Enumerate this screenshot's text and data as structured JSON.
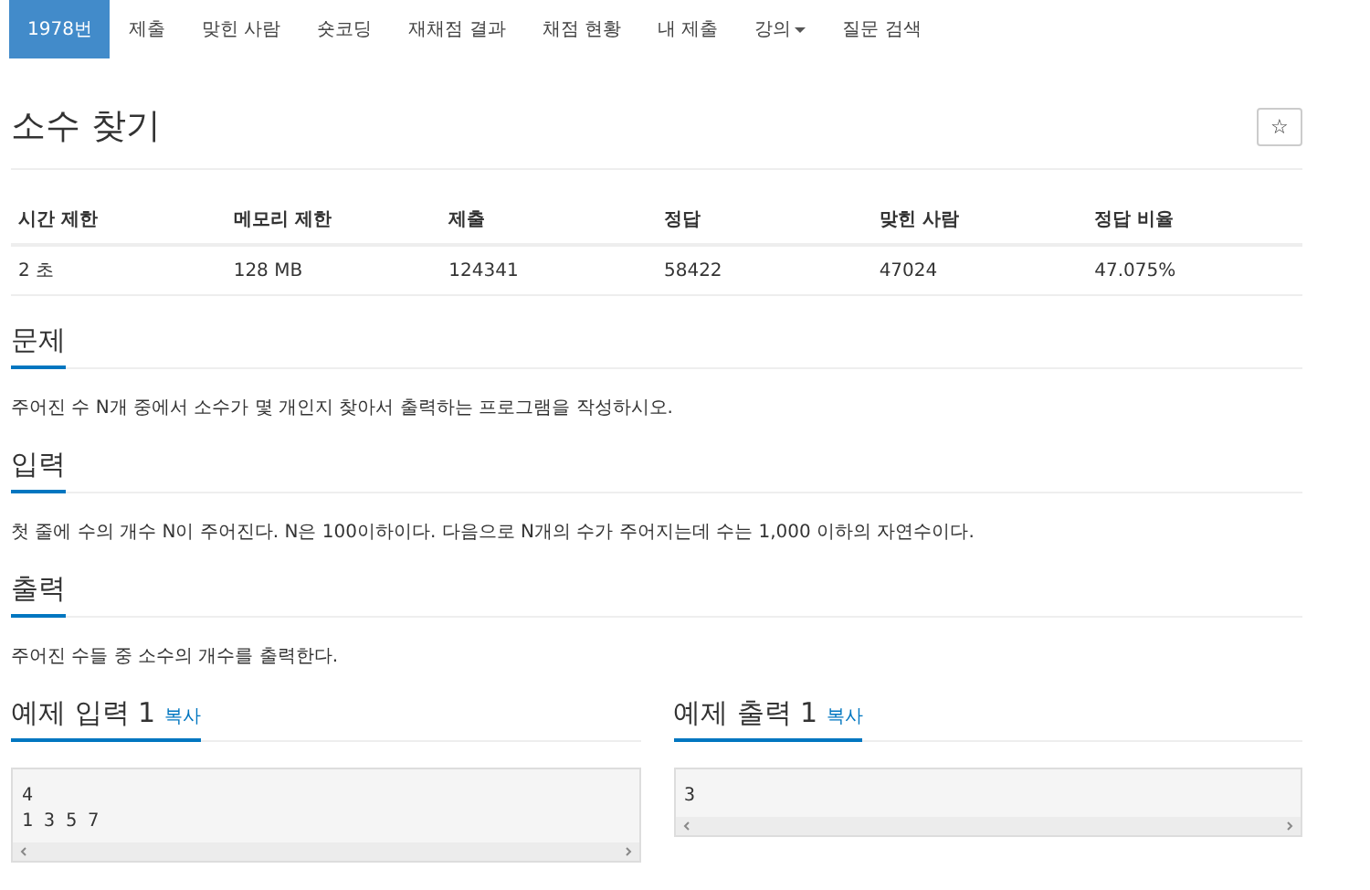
{
  "nav": [
    {
      "label": "1978번",
      "selected": true,
      "dropdown": false
    },
    {
      "label": "제출",
      "selected": false,
      "dropdown": false
    },
    {
      "label": "맞힌 사람",
      "selected": false,
      "dropdown": false
    },
    {
      "label": "숏코딩",
      "selected": false,
      "dropdown": false
    },
    {
      "label": "재채점 결과",
      "selected": false,
      "dropdown": false
    },
    {
      "label": "채점 현황",
      "selected": false,
      "dropdown": false
    },
    {
      "label": "내 제출",
      "selected": false,
      "dropdown": false
    },
    {
      "label": "강의",
      "selected": false,
      "dropdown": true
    },
    {
      "label": "질문 검색",
      "selected": false,
      "dropdown": false
    }
  ],
  "title": "소수 찾기",
  "star_button": "☆",
  "info_table": {
    "columns": [
      "시간 제한",
      "메모리 제한",
      "제출",
      "정답",
      "맞힌 사람",
      "정답 비율"
    ],
    "rows": [
      [
        "2 초",
        "128 MB",
        "124341",
        "58422",
        "47024",
        "47.075%"
      ]
    ]
  },
  "sections": [
    {
      "heading": "문제",
      "text": "주어진 수 N개 중에서 소수가 몇 개인지 찾아서 출력하는 프로그램을 작성하시오."
    },
    {
      "heading": "입력",
      "text": "첫 줄에 수의 개수 N이 주어진다. N은 100이하이다. 다음으로 N개의 수가 주어지는데 수는 1,000 이하의 자연수이다."
    },
    {
      "heading": "출력",
      "text": "주어진 수들 중 소수의 개수를 출력한다."
    }
  ],
  "samples": [
    {
      "heading": "예제 입력 1",
      "copy": "복사",
      "lines": [
        "4",
        "1 3 5 7"
      ]
    },
    {
      "heading": "예제 출력 1",
      "copy": "복사",
      "lines": [
        "3"
      ]
    }
  ]
}
